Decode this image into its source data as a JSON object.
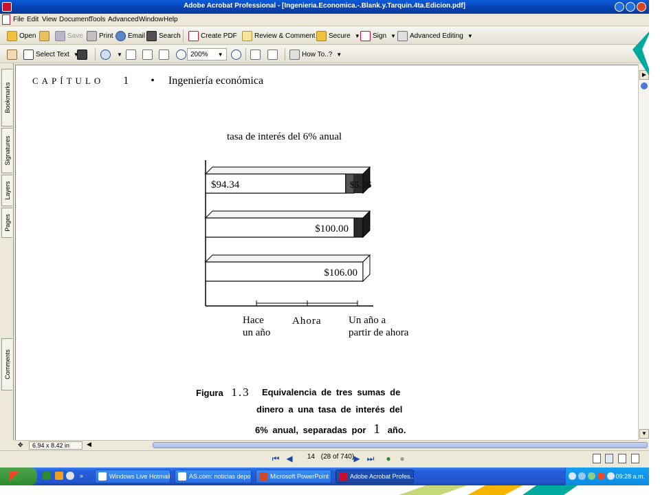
{
  "window": {
    "title": "Adobe Acrobat Professional - [Ingenieria.Economica.-.Blank.y.Tarquin.4ta.Edicion.pdf]"
  },
  "menu": [
    "File",
    "Edit",
    "View",
    "Document",
    "Tools",
    "Advanced",
    "Window",
    "Help"
  ],
  "toolbar1": {
    "open": "Open",
    "save": "Save",
    "print": "Print",
    "email": "Email",
    "search": "Search",
    "create_pdf": "Create PDF",
    "review": "Review & Comment",
    "secure": "Secure",
    "sign": "Sign",
    "advanced_editing": "Advanced Editing"
  },
  "toolbar2": {
    "select_text": "Select Text",
    "zoom": "200%",
    "how_to": "How To..?"
  },
  "nav_tabs": [
    "Bookmarks",
    "Signatures",
    "Layers",
    "Pages",
    "Comments"
  ],
  "document": {
    "chapter_word": "CAPÍTULO",
    "chapter_number": "1",
    "chapter_bullet": "•",
    "chapter_title": "Ingeniería económica",
    "figure_title": "tasa de interés del 6% anual",
    "axis_labels": [
      [
        "Hace",
        "un año"
      ],
      [
        "Ahora"
      ],
      [
        "Un año a",
        "partir de ahora"
      ]
    ],
    "caption": {
      "label": "Figura",
      "number": "1.3",
      "lines": [
        "Equivalencia de tres sumas de",
        "dinero a una tasa de interés del",
        "6% anual, separadas por",
        "1",
        "año."
      ]
    }
  },
  "chart_data": {
    "type": "bar",
    "orientation": "horizontal",
    "title": "tasa de interés del 6% anual",
    "categories": [
      "Hace un año",
      "Ahora",
      "Un año a partir de ahora"
    ],
    "series": [
      {
        "name": "",
        "values": [
          94.34,
          100.0,
          106.0
        ]
      },
      {
        "name": "",
        "values": [
          5.66,
          6.0,
          0
        ]
      }
    ],
    "data_labels": [
      "$94.34",
      "$5.66",
      "$100.00",
      "$106.00"
    ],
    "grid": false
  },
  "status": {
    "page_size": "6.94 x 8.42 in",
    "page_num": "14",
    "page_of": "(28 of 740)"
  },
  "taskbar": {
    "tasks": [
      "Windows Live Hotmail ...",
      "AS.com: noticias depo...",
      "Microsoft PowerPoint -...",
      "Adobe Acrobat Profes..."
    ],
    "clock": "09:28 a.m."
  },
  "colors": {
    "title_bar": "#0842b0",
    "taskbar": "#245edb",
    "interest_fill": "#2a2a2a"
  }
}
